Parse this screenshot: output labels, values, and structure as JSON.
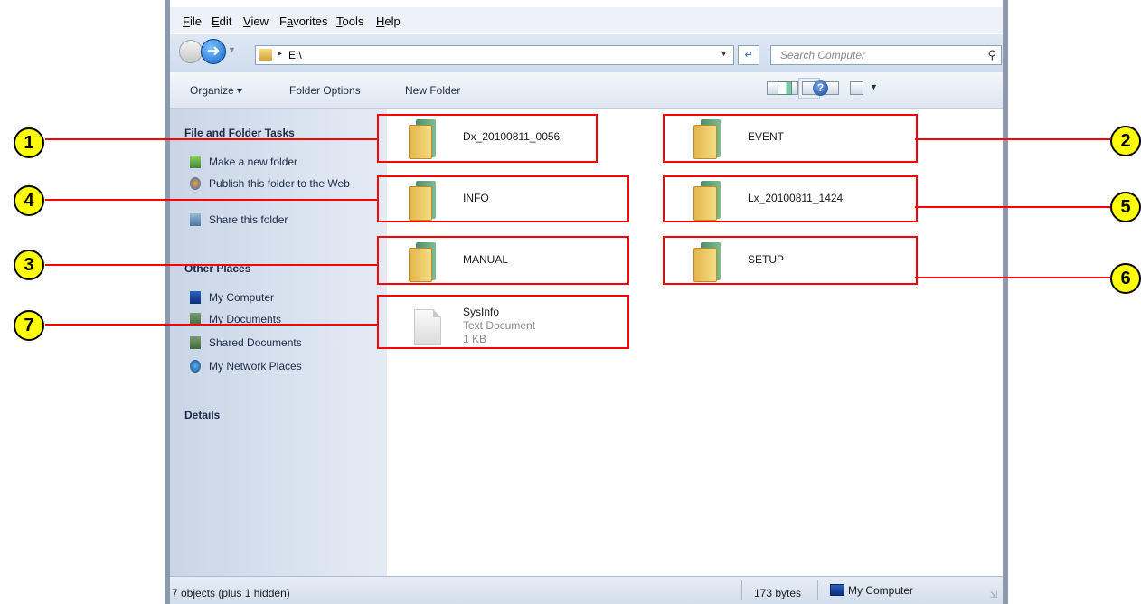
{
  "menu": [
    "File",
    "Edit",
    "View",
    "Favorites",
    "Tools",
    "Help"
  ],
  "menu_mnemonics": [
    "F",
    "E",
    "V",
    "a",
    "T",
    "H"
  ],
  "address": {
    "path": "E:\\"
  },
  "search": {
    "placeholder": "Search Computer"
  },
  "toolbar": {
    "organize": "Organize ▾",
    "folder_options": "Folder Options",
    "new_folder": "New Folder"
  },
  "tasks": {
    "title": "File and Folder Tasks",
    "items": [
      "Make a new folder",
      "Publish this folder to the Web",
      "Share this folder"
    ]
  },
  "other_places": {
    "title": "Other Places",
    "items": [
      "My Computer",
      "My Documents",
      "Shared Documents",
      "My Network Places"
    ]
  },
  "details": {
    "title": "Details"
  },
  "files": [
    {
      "name": "Dx_20100811_0056",
      "kind": "folder",
      "callout": "1"
    },
    {
      "name": "EVENT",
      "kind": "folder",
      "callout": "2"
    },
    {
      "name": "INFO",
      "kind": "folder",
      "callout": "4"
    },
    {
      "name": "Lx_20100811_1424",
      "kind": "folder",
      "callout": "5"
    },
    {
      "name": "MANUAL",
      "kind": "folder",
      "callout": "3"
    },
    {
      "name": "SETUP",
      "kind": "folder",
      "callout": "6"
    },
    {
      "name": "SysInfo",
      "kind": "text",
      "type": "Text Document",
      "size": "1 KB",
      "callout": "7"
    }
  ],
  "status": {
    "left": "7 objects (plus 1 hidden)",
    "size": "173 bytes",
    "zone": "My Computer"
  },
  "colors": {
    "annotation": "#ff0000",
    "callout_fill": "#ffff00"
  }
}
